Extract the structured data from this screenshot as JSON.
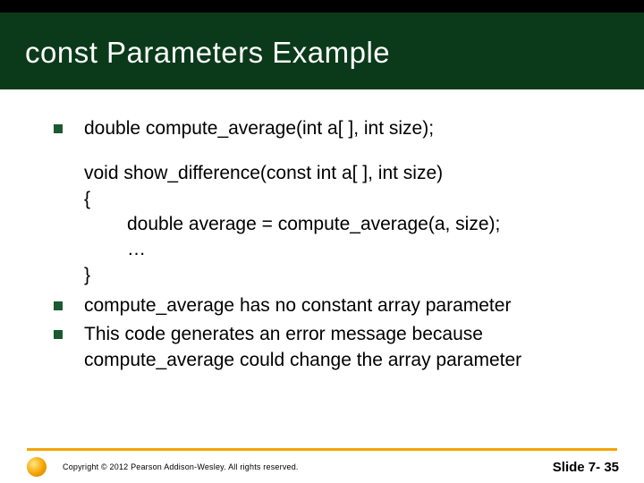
{
  "title": "const Parameters Example",
  "bullets": {
    "b1": "double compute_average(int a[ ], int size);",
    "b2": "compute_average has no constant array parameter",
    "b3": "This code generates an error message because compute_average could change the array parameter"
  },
  "code": {
    "l1": "void show_difference(const int a[ ], int size)",
    "l2": "{",
    "l3": "double average = compute_average(a, size);",
    "l4": "…",
    "l5": "}"
  },
  "footer": {
    "copyright": "Copyright © 2012 Pearson Addison-Wesley.  All rights reserved.",
    "slide": "Slide 7- 35"
  }
}
